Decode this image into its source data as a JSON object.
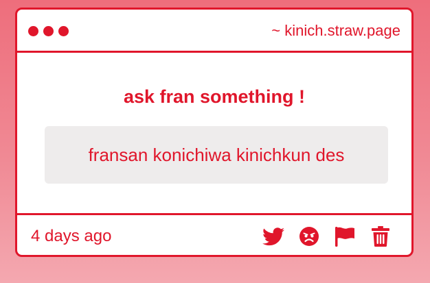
{
  "window": {
    "url": "~ kinich.straw.page"
  },
  "prompt": {
    "title": "ask fran something !"
  },
  "question": {
    "text": "fransan konichiwa kinichkun des"
  },
  "footer": {
    "timestamp": "4 days ago",
    "actions": [
      {
        "icon": "twitter-icon"
      },
      {
        "icon": "angry-face-icon"
      },
      {
        "icon": "flag-icon"
      },
      {
        "icon": "trash-icon"
      }
    ]
  },
  "colors": {
    "accent": "#e0162b",
    "box_bg": "#eeecec",
    "page_bg_top": "#ee6e7c",
    "page_bg_bottom": "#f4a8b0"
  }
}
